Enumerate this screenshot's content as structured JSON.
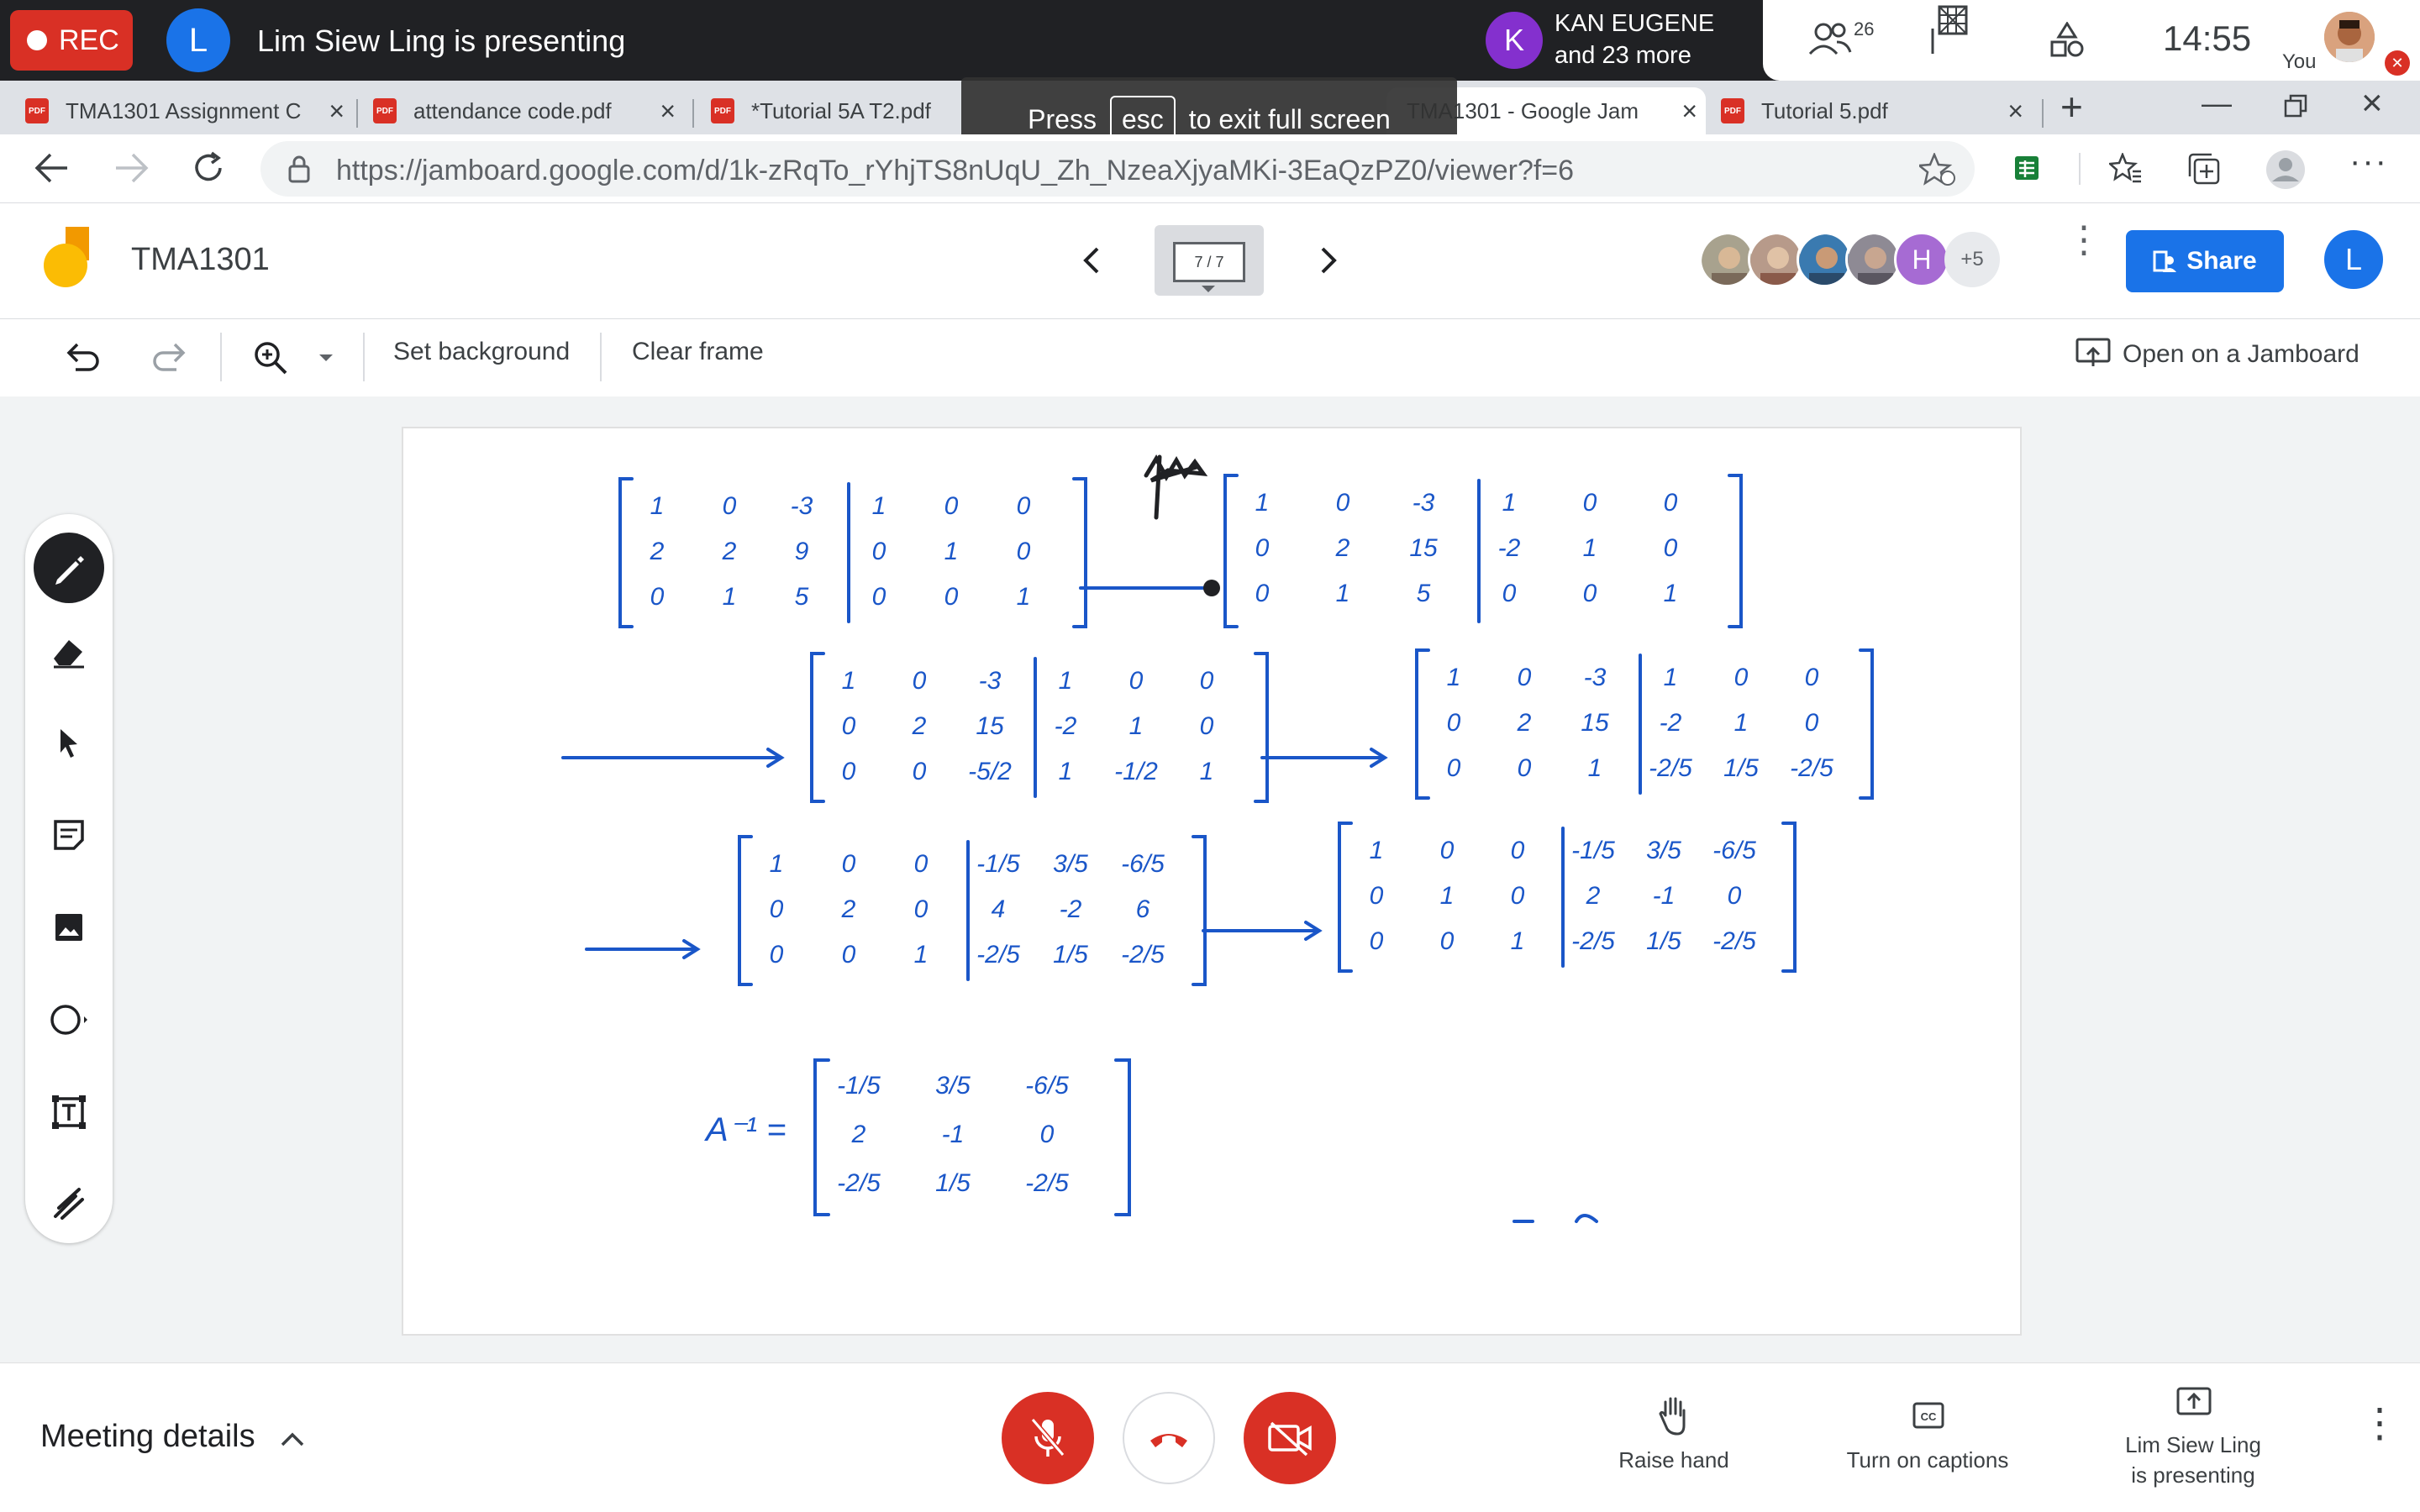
{
  "meet": {
    "rec_label": "REC",
    "presenter_initial": "L",
    "presenting_text": "Lim Siew Ling is presenting",
    "participant_initial": "K",
    "participant_name": "KAN EUGENE",
    "participant_more": "and 23 more",
    "people_count": "26",
    "clock": "14:55",
    "you_label": "You"
  },
  "browser": {
    "tabs": [
      {
        "label": "TMA1301 Assignment C",
        "type": "pdf"
      },
      {
        "label": "attendance code.pdf",
        "type": "pdf"
      },
      {
        "label": "*Tutorial 5A T2.pdf",
        "type": "pdf"
      },
      {
        "label": "TMA1301 - Google Jam",
        "type": "jamboard",
        "active": true
      },
      {
        "label": "Tutorial 5.pdf",
        "type": "pdf"
      }
    ],
    "fullscreen_toast": {
      "prefix": "Press",
      "key": "esc",
      "suffix": "to exit full screen"
    },
    "url": "https://jamboard.google.com/d/1k-zRqTo_rYhjTS8nUqU_Zh_NzeaXjyaMKi-3EaQzPZ0/viewer?f=6"
  },
  "jamboard": {
    "title": "TMA1301",
    "frame_indicator": "7 / 7",
    "collaborators_more": "+5",
    "collaborator_h": "H",
    "share_label": "Share",
    "user_initial": "L",
    "toolbar": {
      "set_background": "Set background",
      "clear_frame": "Clear frame",
      "open_on_jamboard": "Open on a Jamboard"
    },
    "board": {
      "step1_left": [
        [
          "1",
          "0",
          "-3"
        ],
        [
          "2",
          "2",
          "9"
        ],
        [
          "0",
          "1",
          "5"
        ]
      ],
      "step1_right": [
        [
          "1",
          "0",
          "0"
        ],
        [
          "0",
          "1",
          "0"
        ],
        [
          "0",
          "0",
          "1"
        ]
      ],
      "step2_left": [
        [
          "1",
          "0",
          "-3"
        ],
        [
          "0",
          "2",
          "15"
        ],
        [
          "0",
          "1",
          "5"
        ]
      ],
      "step2_right": [
        [
          "1",
          "0",
          "0"
        ],
        [
          "-2",
          "1",
          "0"
        ],
        [
          "0",
          "0",
          "1"
        ]
      ],
      "step3_left": [
        [
          "1",
          "0",
          "-3"
        ],
        [
          "0",
          "2",
          "15"
        ],
        [
          "0",
          "0",
          "-5/2"
        ]
      ],
      "step3_right": [
        [
          "1",
          "0",
          "0"
        ],
        [
          "-2",
          "1",
          "0"
        ],
        [
          "1",
          "-1/2",
          "1"
        ]
      ],
      "step4_left": [
        [
          "1",
          "0",
          "-3"
        ],
        [
          "0",
          "2",
          "15"
        ],
        [
          "0",
          "0",
          "1"
        ]
      ],
      "step4_right": [
        [
          "1",
          "0",
          "0"
        ],
        [
          "-2",
          "1",
          "0"
        ],
        [
          "-2/5",
          "1/5",
          "-2/5"
        ]
      ],
      "step5_left": [
        [
          "1",
          "0",
          "0"
        ],
        [
          "0",
          "2",
          "0"
        ],
        [
          "0",
          "0",
          "1"
        ]
      ],
      "step5_right": [
        [
          "-1/5",
          "3/5",
          "-6/5"
        ],
        [
          "4",
          "-2",
          "6"
        ],
        [
          "-2/5",
          "1/5",
          "-2/5"
        ]
      ],
      "step6_left": [
        [
          "1",
          "0",
          "0"
        ],
        [
          "0",
          "1",
          "0"
        ],
        [
          "0",
          "0",
          "1"
        ]
      ],
      "step6_right": [
        [
          "-1/5",
          "3/5",
          "-6/5"
        ],
        [
          "2",
          "-1",
          "0"
        ],
        [
          "-2/5",
          "1/5",
          "-2/5"
        ]
      ],
      "inverse_label": "A⁻¹ =",
      "inverse": [
        [
          "-1/5",
          "3/5",
          "-6/5"
        ],
        [
          "2",
          "-1",
          "0"
        ],
        [
          "-2/5",
          "1/5",
          "-2/5"
        ]
      ],
      "ink_color": "#1a56c8"
    }
  },
  "bottom": {
    "meeting_details": "Meeting details",
    "raise_hand": "Raise hand",
    "captions": "Turn on captions",
    "presenting_line1": "Lim Siew Ling",
    "presenting_line2": "is presenting"
  },
  "colors": {
    "danger": "#d93025",
    "primary": "#1a73e8",
    "jamboard_yellow": "#fbbc04",
    "jamboard_orange": "#f29900"
  }
}
